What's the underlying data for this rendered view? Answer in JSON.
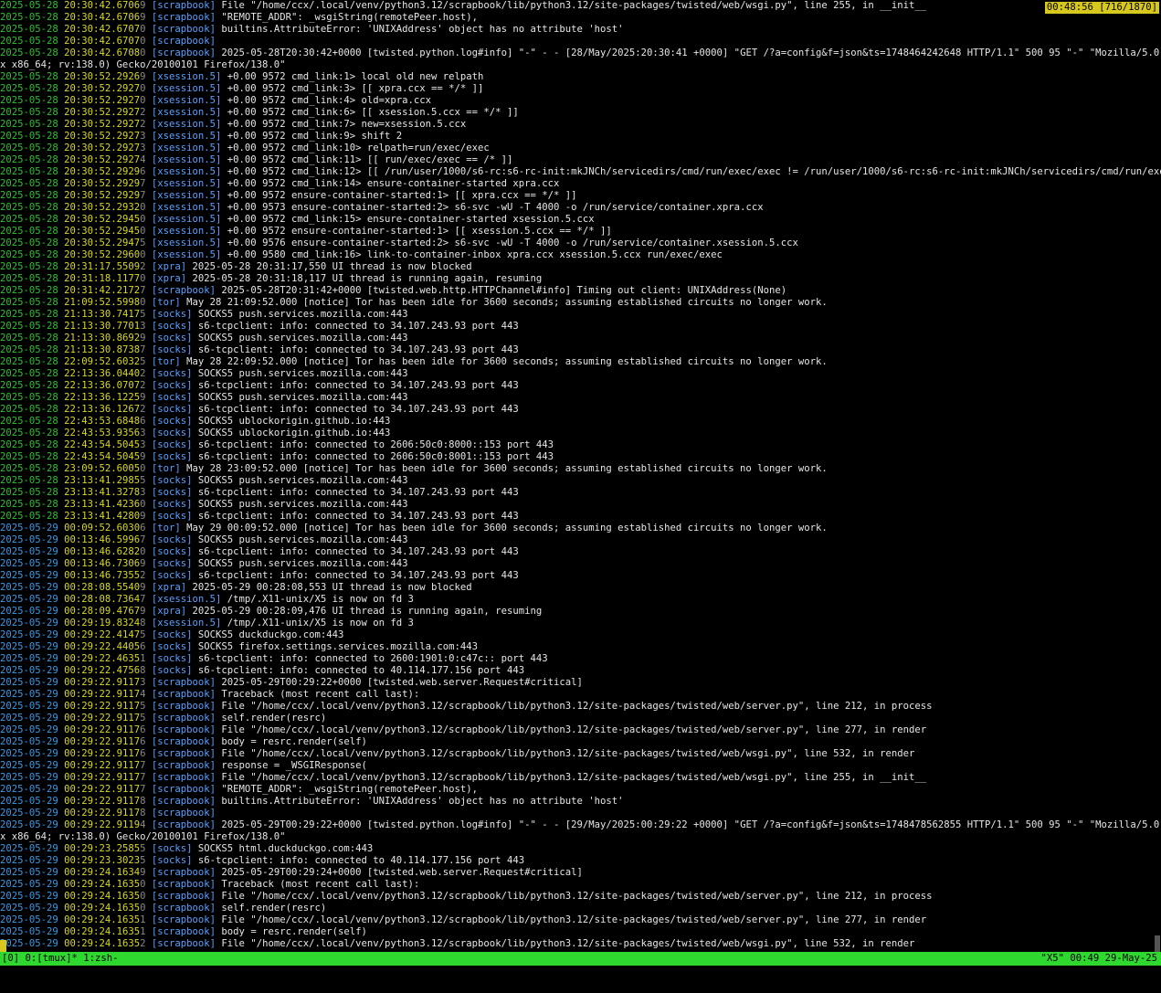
{
  "pager": "00:48:56 [716/1870]",
  "status": {
    "left": "[0] 0:[tmux]* 1:zsh-",
    "right": "\"X5\" 00:49 29-May-25"
  },
  "lines": [
    {
      "d": "2025-05-28",
      "t": "20:30:42.6706",
      "f": "9",
      "g": "[scrapbook]",
      "m": " File \"/home/ccx/.local/venv/python3.12/scrapbook/lib/python3.12/site-packages/twisted/web/wsgi.py\", line 255, in __init__"
    },
    {
      "d": "2025-05-28",
      "t": "20:30:42.6706",
      "f": "9",
      "g": "[scrapbook]",
      "m": " \"REMOTE_ADDR\": _wsgiString(remotePeer.host),"
    },
    {
      "d": "2025-05-28",
      "t": "20:30:42.6707",
      "f": "0",
      "g": "[scrapbook]",
      "m": " builtins.AttributeError: 'UNIXAddress' object has no attribute 'host'"
    },
    {
      "d": "2025-05-28",
      "t": "20:30:42.6707",
      "f": "0",
      "g": "[scrapbook]",
      "m": ""
    },
    {
      "d": "2025-05-28",
      "t": "20:30:42.6708",
      "f": "0",
      "g": "[scrapbook]",
      "m": " 2025-05-28T20:30:42+0000 [twisted.python.log#info] \"-\" - - [28/May/2025:20:30:41 +0000] \"GET /?a=config&f=json&ts=1748464242648 HTTP/1.1\" 500 95 \"-\" \"Mozilla/5.0 (X11; Linu"
    },
    {
      "c": "x x86_64; rv:138.0) Gecko/20100101 Firefox/138.0\""
    },
    {
      "d": "2025-05-28",
      "t": "20:30:52.2926",
      "f": "9",
      "g": "[xsession.5]",
      "m": " +0.00 9572 cmd_link:1> local old new relpath"
    },
    {
      "d": "2025-05-28",
      "t": "20:30:52.2927",
      "f": "0",
      "g": "[xsession.5]",
      "m": " +0.00 9572 cmd_link:3> [[ xpra.ccx == */* ]]"
    },
    {
      "d": "2025-05-28",
      "t": "20:30:52.2927",
      "f": "0",
      "g": "[xsession.5]",
      "m": " +0.00 9572 cmd_link:4> old=xpra.ccx"
    },
    {
      "d": "2025-05-28",
      "t": "20:30:52.2927",
      "f": "2",
      "g": "[xsession.5]",
      "m": " +0.00 9572 cmd_link:6> [[ xsession.5.ccx == */* ]]"
    },
    {
      "d": "2025-05-28",
      "t": "20:30:52.2927",
      "f": "2",
      "g": "[xsession.5]",
      "m": " +0.00 9572 cmd_link:7> new=xsession.5.ccx"
    },
    {
      "d": "2025-05-28",
      "t": "20:30:52.2927",
      "f": "3",
      "g": "[xsession.5]",
      "m": " +0.00 9572 cmd_link:9> shift 2"
    },
    {
      "d": "2025-05-28",
      "t": "20:30:52.2927",
      "f": "3",
      "g": "[xsession.5]",
      "m": " +0.00 9572 cmd_link:10> relpath=run/exec/exec"
    },
    {
      "d": "2025-05-28",
      "t": "20:30:52.2927",
      "f": "4",
      "g": "[xsession.5]",
      "m": " +0.00 9572 cmd_link:11> [[ run/exec/exec == /* ]]"
    },
    {
      "d": "2025-05-28",
      "t": "20:30:52.2929",
      "f": "6",
      "g": "[xsession.5]",
      "m": " +0.00 9572 cmd_link:12> [[ /run/user/1000/s6-rc:s6-rc-init:mkJNCh/servicedirs/cmd/run/exec/exec != /run/user/1000/s6-rc:s6-rc-init:mkJNCh/servicedirs/cmd/run/exec/exec ]]"
    },
    {
      "d": "2025-05-28",
      "t": "20:30:52.2929",
      "f": "7",
      "g": "[xsession.5]",
      "m": " +0.00 9572 cmd_link:14> ensure-container-started xpra.ccx"
    },
    {
      "d": "2025-05-28",
      "t": "20:30:52.2929",
      "f": "7",
      "g": "[xsession.5]",
      "m": " +0.00 9572 ensure-container-started:1> [[ xpra.ccx == */* ]]"
    },
    {
      "d": "2025-05-28",
      "t": "20:30:52.2932",
      "f": "0",
      "g": "[xsession.5]",
      "m": " +0.00 9573 ensure-container-started:2> s6-svc -wU -T 4000 -o /run/service/container.xpra.ccx"
    },
    {
      "d": "2025-05-28",
      "t": "20:30:52.2945",
      "f": "0",
      "g": "[xsession.5]",
      "m": " +0.00 9572 cmd_link:15> ensure-container-started xsession.5.ccx"
    },
    {
      "d": "2025-05-28",
      "t": "20:30:52.2945",
      "f": "0",
      "g": "[xsession.5]",
      "m": " +0.00 9572 ensure-container-started:1> [[ xsession.5.ccx == */* ]]"
    },
    {
      "d": "2025-05-28",
      "t": "20:30:52.2947",
      "f": "5",
      "g": "[xsession.5]",
      "m": " +0.00 9576 ensure-container-started:2> s6-svc -wU -T 4000 -o /run/service/container.xsession.5.ccx"
    },
    {
      "d": "2025-05-28",
      "t": "20:30:52.2960",
      "f": "0",
      "g": "[xsession.5]",
      "m": " +0.00 9580 cmd_link:16> link-to-container-inbox xpra.ccx xsession.5.ccx run/exec/exec"
    },
    {
      "d": "2025-05-28",
      "t": "20:31:17.5509",
      "f": "2",
      "g": "[xpra]",
      "m": " 2025-05-28 20:31:17,550 UI thread is now blocked"
    },
    {
      "d": "2025-05-28",
      "t": "20:31:18.1177",
      "f": "0",
      "g": "[xpra]",
      "m": " 2025-05-28 20:31:18,117 UI thread is running again, resuming"
    },
    {
      "d": "2025-05-28",
      "t": "20:31:42.2172",
      "f": "7",
      "g": "[scrapbook]",
      "m": " 2025-05-28T20:31:42+0000 [twisted.web.http.HTTPChannel#info] Timing out client: UNIXAddress(None)"
    },
    {
      "d": "2025-05-28",
      "t": "21:09:52.5998",
      "f": "0",
      "g": "[tor]",
      "m": " May 28 21:09:52.000 [notice] Tor has been idle for 3600 seconds; assuming established circuits no longer work."
    },
    {
      "d": "2025-05-28",
      "t": "21:13:30.7417",
      "f": "5",
      "g": "[socks]",
      "m": " SOCKS5 push.services.mozilla.com:443"
    },
    {
      "d": "2025-05-28",
      "t": "21:13:30.7701",
      "f": "3",
      "g": "[socks]",
      "m": " s6-tcpclient: info: connected to 34.107.243.93 port 443"
    },
    {
      "d": "2025-05-28",
      "t": "21:13:30.8692",
      "f": "9",
      "g": "[socks]",
      "m": " SOCKS5 push.services.mozilla.com:443"
    },
    {
      "d": "2025-05-28",
      "t": "21:13:30.8738",
      "f": "7",
      "g": "[socks]",
      "m": " s6-tcpclient: info: connected to 34.107.243.93 port 443"
    },
    {
      "d": "2025-05-28",
      "t": "22:09:52.6032",
      "f": "5",
      "g": "[tor]",
      "m": " May 28 22:09:52.000 [notice] Tor has been idle for 3600 seconds; assuming established circuits no longer work."
    },
    {
      "d": "2025-05-28",
      "t": "22:13:36.0440",
      "f": "2",
      "g": "[socks]",
      "m": " SOCKS5 push.services.mozilla.com:443"
    },
    {
      "d": "2025-05-28",
      "t": "22:13:36.0707",
      "f": "2",
      "g": "[socks]",
      "m": " s6-tcpclient: info: connected to 34.107.243.93 port 443"
    },
    {
      "d": "2025-05-28",
      "t": "22:13:36.1225",
      "f": "9",
      "g": "[socks]",
      "m": " SOCKS5 push.services.mozilla.com:443"
    },
    {
      "d": "2025-05-28",
      "t": "22:13:36.1267",
      "f": "2",
      "g": "[socks]",
      "m": " s6-tcpclient: info: connected to 34.107.243.93 port 443"
    },
    {
      "d": "2025-05-28",
      "t": "22:43:53.6848",
      "f": "6",
      "g": "[socks]",
      "m": " SOCKS5 ublockorigin.github.io:443"
    },
    {
      "d": "2025-05-28",
      "t": "22:43:53.9356",
      "f": "3",
      "g": "[socks]",
      "m": " SOCKS5 ublockorigin.github.io:443"
    },
    {
      "d": "2025-05-28",
      "t": "22:43:54.5045",
      "f": "3",
      "g": "[socks]",
      "m": " s6-tcpclient: info: connected to 2606:50c0:8000::153 port 443"
    },
    {
      "d": "2025-05-28",
      "t": "22:43:54.5045",
      "f": "9",
      "g": "[socks]",
      "m": " s6-tcpclient: info: connected to 2606:50c0:8001::153 port 443"
    },
    {
      "d": "2025-05-28",
      "t": "23:09:52.6005",
      "f": "0",
      "g": "[tor]",
      "m": " May 28 23:09:52.000 [notice] Tor has been idle for 3600 seconds; assuming established circuits no longer work."
    },
    {
      "d": "2025-05-28",
      "t": "23:13:41.2985",
      "f": "5",
      "g": "[socks]",
      "m": " SOCKS5 push.services.mozilla.com:443"
    },
    {
      "d": "2025-05-28",
      "t": "23:13:41.3278",
      "f": "3",
      "g": "[socks]",
      "m": " s6-tcpclient: info: connected to 34.107.243.93 port 443"
    },
    {
      "d": "2025-05-28",
      "t": "23:13:41.4236",
      "f": "0",
      "g": "[socks]",
      "m": " SOCKS5 push.services.mozilla.com:443"
    },
    {
      "d": "2025-05-28",
      "t": "23:13:41.4280",
      "f": "9",
      "g": "[socks]",
      "m": " s6-tcpclient: info: connected to 34.107.243.93 port 443"
    },
    {
      "d": "2025-05-29",
      "t": "00:09:52.6030",
      "f": "6",
      "g": "[tor]",
      "m": " May 29 00:09:52.000 [notice] Tor has been idle for 3600 seconds; assuming established circuits no longer work."
    },
    {
      "d": "2025-05-29",
      "t": "00:13:46.5996",
      "f": "7",
      "g": "[socks]",
      "m": " SOCKS5 push.services.mozilla.com:443"
    },
    {
      "d": "2025-05-29",
      "t": "00:13:46.6282",
      "f": "0",
      "g": "[socks]",
      "m": " s6-tcpclient: info: connected to 34.107.243.93 port 443"
    },
    {
      "d": "2025-05-29",
      "t": "00:13:46.7306",
      "f": "9",
      "g": "[socks]",
      "m": " SOCKS5 push.services.mozilla.com:443"
    },
    {
      "d": "2025-05-29",
      "t": "00:13:46.7355",
      "f": "2",
      "g": "[socks]",
      "m": " s6-tcpclient: info: connected to 34.107.243.93 port 443"
    },
    {
      "d": "2025-05-29",
      "t": "00:28:08.5540",
      "f": "9",
      "g": "[xpra]",
      "m": " 2025-05-29 00:28:08,553 UI thread is now blocked"
    },
    {
      "d": "2025-05-29",
      "t": "00:28:08.7364",
      "f": "7",
      "g": "[xsession.5]",
      "m": " /tmp/.X11-unix/X5 is now on fd 3"
    },
    {
      "d": "2025-05-29",
      "t": "00:28:09.4767",
      "f": "9",
      "g": "[xpra]",
      "m": " 2025-05-29 00:28:09,476 UI thread is running again, resuming"
    },
    {
      "d": "2025-05-29",
      "t": "00:29:19.8324",
      "f": "8",
      "g": "[xsession.5]",
      "m": " /tmp/.X11-unix/X5 is now on fd 3"
    },
    {
      "d": "2025-05-29",
      "t": "00:29:22.4147",
      "f": "5",
      "g": "[socks]",
      "m": " SOCKS5 duckduckgo.com:443"
    },
    {
      "d": "2025-05-29",
      "t": "00:29:22.4405",
      "f": "6",
      "g": "[socks]",
      "m": " SOCKS5 firefox.settings.services.mozilla.com:443"
    },
    {
      "d": "2025-05-29",
      "t": "00:29:22.4635",
      "f": "1",
      "g": "[socks]",
      "m": " s6-tcpclient: info: connected to 2600:1901:0:c47c:: port 443"
    },
    {
      "d": "2025-05-29",
      "t": "00:29:22.4756",
      "f": "8",
      "g": "[socks]",
      "m": " s6-tcpclient: info: connected to 40.114.177.156 port 443"
    },
    {
      "d": "2025-05-29",
      "t": "00:29:22.9117",
      "f": "3",
      "g": "[scrapbook]",
      "m": " 2025-05-29T00:29:22+0000 [twisted.web.server.Request#critical]"
    },
    {
      "d": "2025-05-29",
      "t": "00:29:22.9117",
      "f": "4",
      "g": "[scrapbook]",
      "m": " Traceback (most recent call last):"
    },
    {
      "d": "2025-05-29",
      "t": "00:29:22.9117",
      "f": "5",
      "g": "[scrapbook]",
      "m": " File \"/home/ccx/.local/venv/python3.12/scrapbook/lib/python3.12/site-packages/twisted/web/server.py\", line 212, in process"
    },
    {
      "d": "2025-05-29",
      "t": "00:29:22.9117",
      "f": "5",
      "g": "[scrapbook]",
      "m": " self.render(resrc)"
    },
    {
      "d": "2025-05-29",
      "t": "00:29:22.9117",
      "f": "6",
      "g": "[scrapbook]",
      "m": " File \"/home/ccx/.local/venv/python3.12/scrapbook/lib/python3.12/site-packages/twisted/web/server.py\", line 277, in render"
    },
    {
      "d": "2025-05-29",
      "t": "00:29:22.9117",
      "f": "6",
      "g": "[scrapbook]",
      "m": " body = resrc.render(self)"
    },
    {
      "d": "2025-05-29",
      "t": "00:29:22.9117",
      "f": "6",
      "g": "[scrapbook]",
      "m": " File \"/home/ccx/.local/venv/python3.12/scrapbook/lib/python3.12/site-packages/twisted/web/wsgi.py\", line 532, in render"
    },
    {
      "d": "2025-05-29",
      "t": "00:29:22.9117",
      "f": "7",
      "g": "[scrapbook]",
      "m": " response = _WSGIResponse("
    },
    {
      "d": "2025-05-29",
      "t": "00:29:22.9117",
      "f": "7",
      "g": "[scrapbook]",
      "m": " File \"/home/ccx/.local/venv/python3.12/scrapbook/lib/python3.12/site-packages/twisted/web/wsgi.py\", line 255, in __init__"
    },
    {
      "d": "2025-05-29",
      "t": "00:29:22.9117",
      "f": "7",
      "g": "[scrapbook]",
      "m": " \"REMOTE_ADDR\": _wsgiString(remotePeer.host),"
    },
    {
      "d": "2025-05-29",
      "t": "00:29:22.9117",
      "f": "8",
      "g": "[scrapbook]",
      "m": " builtins.AttributeError: 'UNIXAddress' object has no attribute 'host'"
    },
    {
      "d": "2025-05-29",
      "t": "00:29:22.9117",
      "f": "8",
      "g": "[scrapbook]",
      "m": ""
    },
    {
      "d": "2025-05-29",
      "t": "00:29:22.9119",
      "f": "4",
      "g": "[scrapbook]",
      "m": " 2025-05-29T00:29:22+0000 [twisted.python.log#info] \"-\" - - [29/May/2025:00:29:22 +0000] \"GET /?a=config&f=json&ts=1748478562855 HTTP/1.1\" 500 95 \"-\" \"Mozilla/5.0 (X11; Linu"
    },
    {
      "c": "x x86_64; rv:138.0) Gecko/20100101 Firefox/138.0\""
    },
    {
      "d": "2025-05-29",
      "t": "00:29:23.2585",
      "f": "5",
      "g": "[socks]",
      "m": " SOCKS5 html.duckduckgo.com:443"
    },
    {
      "d": "2025-05-29",
      "t": "00:29:23.3023",
      "f": "5",
      "g": "[socks]",
      "m": " s6-tcpclient: info: connected to 40.114.177.156 port 443"
    },
    {
      "d": "2025-05-29",
      "t": "00:29:24.1634",
      "f": "9",
      "g": "[scrapbook]",
      "m": " 2025-05-29T00:29:24+0000 [twisted.web.server.Request#critical]"
    },
    {
      "d": "2025-05-29",
      "t": "00:29:24.1635",
      "f": "0",
      "g": "[scrapbook]",
      "m": " Traceback (most recent call last):"
    },
    {
      "d": "2025-05-29",
      "t": "00:29:24.1635",
      "f": "0",
      "g": "[scrapbook]",
      "m": " File \"/home/ccx/.local/venv/python3.12/scrapbook/lib/python3.12/site-packages/twisted/web/server.py\", line 212, in process"
    },
    {
      "d": "2025-05-29",
      "t": "00:29:24.1635",
      "f": "0",
      "g": "[scrapbook]",
      "m": " self.render(resrc)"
    },
    {
      "d": "2025-05-29",
      "t": "00:29:24.1635",
      "f": "1",
      "g": "[scrapbook]",
      "m": " File \"/home/ccx/.local/venv/python3.12/scrapbook/lib/python3.12/site-packages/twisted/web/server.py\", line 277, in render"
    },
    {
      "d": "2025-05-29",
      "t": "00:29:24.1635",
      "f": "1",
      "g": "[scrapbook]",
      "m": " body = resrc.render(self)"
    },
    {
      "d": "2025-05-29",
      "t": "00:29:24.1635",
      "f": "2",
      "g": "[scrapbook]",
      "m": " File \"/home/ccx/.local/venv/python3.12/scrapbook/lib/python3.12/site-packages/twisted/web/wsgi.py\", line 532, in render"
    }
  ]
}
